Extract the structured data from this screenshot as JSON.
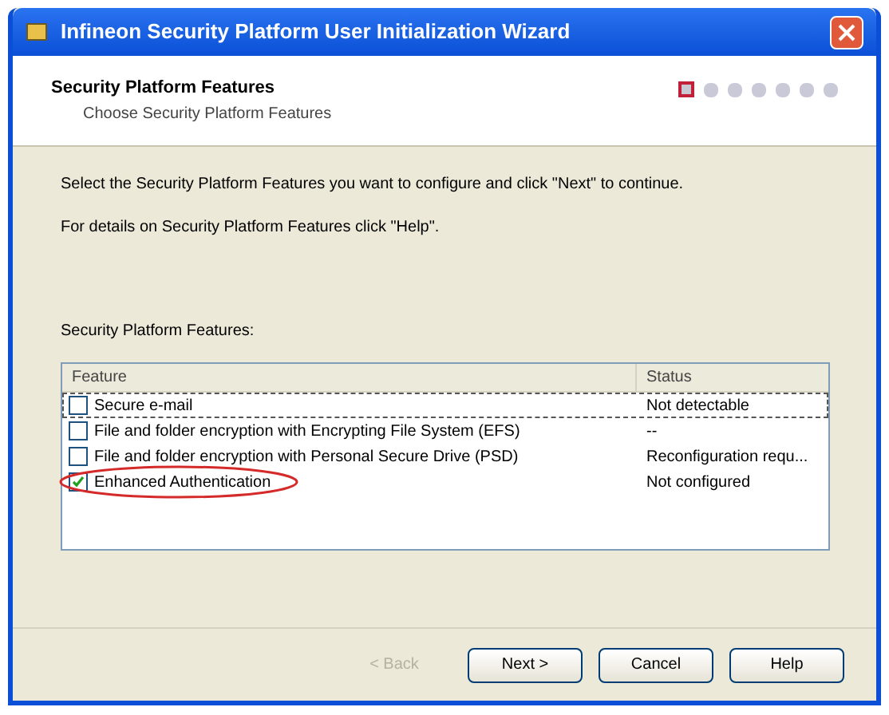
{
  "window": {
    "title": "Infineon Security Platform User Initialization Wizard"
  },
  "header": {
    "title": "Security Platform Features",
    "subtitle": "Choose Security Platform Features",
    "steps": [
      {
        "selected": true
      },
      {
        "selected": false
      },
      {
        "selected": false
      },
      {
        "selected": false
      },
      {
        "selected": false
      },
      {
        "selected": false
      },
      {
        "selected": false
      }
    ]
  },
  "instructions": [
    "Select the Security Platform Features you want to configure and click \"Next\" to continue.",
    "For details on Security Platform Features click \"Help\"."
  ],
  "list_label": "Security Platform Features:",
  "table": {
    "columns": [
      "Feature",
      "Status"
    ],
    "rows": [
      {
        "feature": "Secure e-mail",
        "status": "Not detectable",
        "checked": false,
        "selected": true,
        "circled": false
      },
      {
        "feature": "File and folder encryption with Encrypting File System (EFS)",
        "status": "--",
        "checked": false,
        "selected": false,
        "circled": false
      },
      {
        "feature": "File and folder encryption with Personal Secure Drive (PSD)",
        "status": "Reconfiguration requ...",
        "checked": false,
        "selected": false,
        "circled": false
      },
      {
        "feature": "Enhanced Authentication",
        "status": "Not configured",
        "checked": true,
        "selected": false,
        "circled": true
      }
    ]
  },
  "buttons": [
    {
      "label": "< Back",
      "disabled": true
    },
    {
      "label": "Next >",
      "disabled": false
    },
    {
      "label": "Cancel",
      "disabled": false
    },
    {
      "label": "Help",
      "disabled": false
    }
  ]
}
